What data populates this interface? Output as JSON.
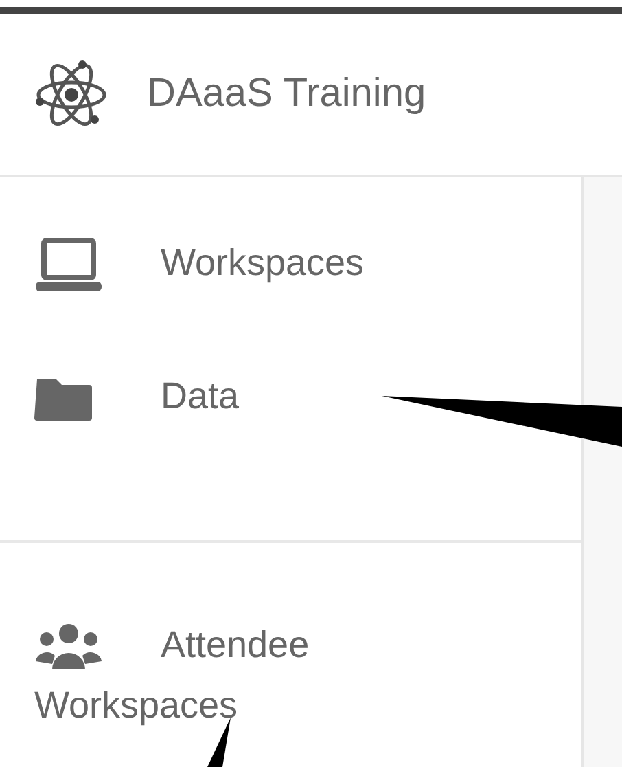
{
  "header": {
    "title": "DAaaS Training"
  },
  "nav_groups": [
    {
      "items": [
        {
          "label": "Workspaces",
          "kind": "laptop"
        },
        {
          "label": "Data",
          "kind": "folder"
        }
      ]
    },
    {
      "items": [
        {
          "label": "Attendee Workspaces",
          "kind": "people"
        }
      ]
    }
  ]
}
